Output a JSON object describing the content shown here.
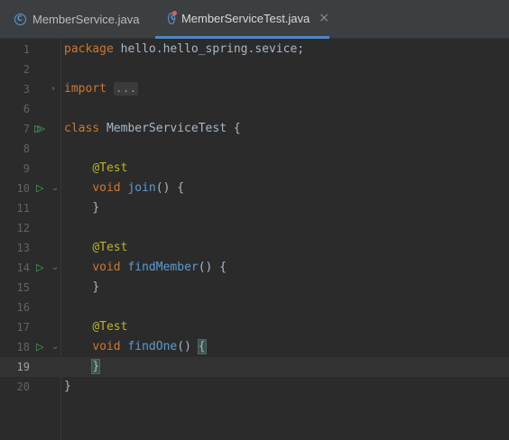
{
  "tabs": [
    {
      "label": "MemberService.java",
      "icon": "java-class-icon",
      "active": false
    },
    {
      "label": "MemberServiceTest.java",
      "icon": "java-test-class-icon",
      "active": true,
      "close": "×"
    }
  ],
  "editor": {
    "current_line": 19,
    "lines": [
      {
        "n": "1"
      },
      {
        "n": "2"
      },
      {
        "n": "3"
      },
      {
        "n": "6"
      },
      {
        "n": "7"
      },
      {
        "n": "8"
      },
      {
        "n": "9"
      },
      {
        "n": "10"
      },
      {
        "n": "11"
      },
      {
        "n": "12"
      },
      {
        "n": "13"
      },
      {
        "n": "14"
      },
      {
        "n": "15"
      },
      {
        "n": "16"
      },
      {
        "n": "17"
      },
      {
        "n": "18"
      },
      {
        "n": "19"
      },
      {
        "n": "20"
      }
    ],
    "code": {
      "package_kw": "package",
      "package_name": " hello.hello_spring.sevice;",
      "import_kw": "import",
      "import_fold": "...",
      "class_kw": "class",
      "class_name": " MemberServiceTest {",
      "ann": "@Test",
      "void_kw": "void",
      "m1": "join",
      "m2": "findMember",
      "m3": "findOne",
      "parens_open": "() {",
      "parens": "() ",
      "open_brace": "{",
      "close_brace": "}"
    }
  },
  "colors": {
    "background": "#2b2b2b",
    "keyword": "#cc7832",
    "annotation": "#bbb529",
    "method": "#5b9bd5",
    "text": "#a9b7c6",
    "run_icon": "#4eab5e",
    "active_tab_underline": "#4a88c7"
  }
}
